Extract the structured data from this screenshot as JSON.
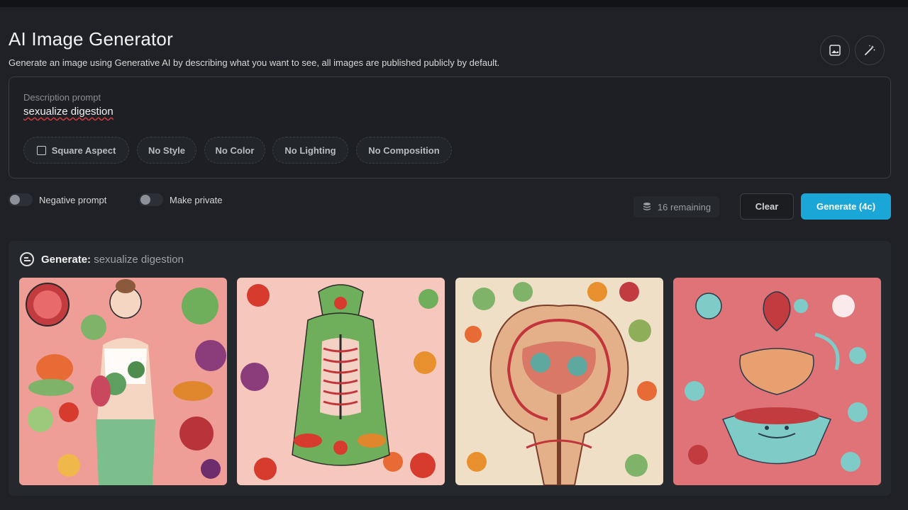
{
  "header": {
    "title": "AI Image Generator",
    "subtitle": "Generate an image using Generative AI by describing what you want to see, all images are published publicly by default."
  },
  "toolbar_icons": [
    "image-icon",
    "magic-wand-icon"
  ],
  "prompt": {
    "label": "Description prompt",
    "value": "sexualize digestion"
  },
  "chips": [
    {
      "label": "Square Aspect",
      "checkbox": true
    },
    {
      "label": "No Style"
    },
    {
      "label": "No Color"
    },
    {
      "label": "No Lighting"
    },
    {
      "label": "No Composition"
    }
  ],
  "toggles": [
    {
      "label": "Negative prompt",
      "on": false
    },
    {
      "label": "Make private",
      "on": false
    }
  ],
  "credits": {
    "remaining_label": "16 remaining",
    "icon": "coin-stack-icon"
  },
  "actions": {
    "clear_label": "Clear",
    "generate_label": "Generate (4c)",
    "generate_color": "#1ba6d8"
  },
  "results": {
    "header_icon": "generate-icon",
    "header_prefix": "Generate:",
    "header_prompt": "sexualize digestion",
    "images": [
      {
        "name": "generated-image-1",
        "bg": "#ef9d97"
      },
      {
        "name": "generated-image-2",
        "bg": "#f6c7bd"
      },
      {
        "name": "generated-image-3",
        "bg": "#eedfc6"
      },
      {
        "name": "generated-image-4",
        "bg": "#df7378"
      }
    ]
  }
}
